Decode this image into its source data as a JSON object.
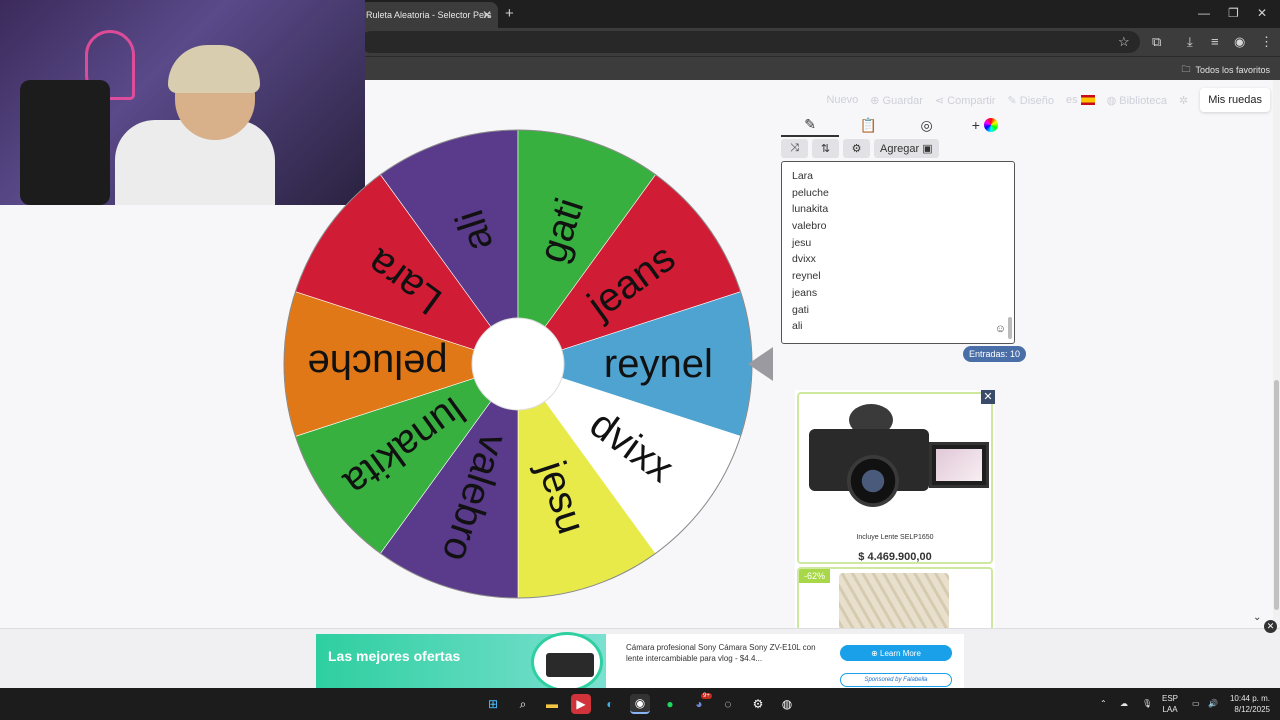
{
  "browser": {
    "tab_title": "Ruleta Aleatoria - Selector Pers",
    "tab_close": "✕",
    "new_tab": "+",
    "bookmarks_all": "Todos los favoritos",
    "window_minimize": "—",
    "window_restore": "❐",
    "window_close": "✕"
  },
  "nav": {
    "nuevo": "Nuevo",
    "guardar": "Guardar",
    "compartir": "Compartir",
    "diseno": "Diseño",
    "lang": "es",
    "biblioteca": "Biblioteca",
    "mis_ruedas": "Mis ruedas"
  },
  "wheel": {
    "segments": [
      {
        "label": "reynel",
        "color": "#4fa3d1"
      },
      {
        "label": "dvixx",
        "color": "#ffffff"
      },
      {
        "label": "jesu",
        "color": "#e8ea4a"
      },
      {
        "label": "valebro",
        "color": "#5a3a8a"
      },
      {
        "label": "lunakita",
        "color": "#38b040"
      },
      {
        "label": "peluche",
        "color": "#e07818"
      },
      {
        "label": "Lara",
        "color": "#d01c34"
      },
      {
        "label": "ali",
        "color": "#5a3a8a"
      },
      {
        "label": "gati",
        "color": "#38b040"
      },
      {
        "label": "jeans",
        "color": "#d01c34"
      }
    ]
  },
  "editor": {
    "tools": {
      "add": "Agregar"
    },
    "entries": [
      "Lara",
      "peluche",
      "lunakita",
      "valebro",
      "jesu",
      "dvixx",
      "reynel",
      "jeans",
      "gati",
      "ali"
    ],
    "count_label": "Entradas: 10"
  },
  "ads": {
    "product1_caption": "Incluye Lente SELP1650",
    "product1_price": "$ 4.469.900,00",
    "product2_discount": "-62%",
    "banner_title": "Las mejores ofertas",
    "banner_text": "Cámara profesional Sony Cámara Sony ZV-E10L con lente intercambiable para vlog - $4.4...",
    "learn_more": "⊕ Learn More",
    "sponsored": "Sponsored by Falabella"
  },
  "taskbar": {
    "lang_top": "ESP",
    "lang_bottom": "LAA",
    "time": "10:44 p. m.",
    "date": "8/12/2025",
    "badge": "9+"
  }
}
